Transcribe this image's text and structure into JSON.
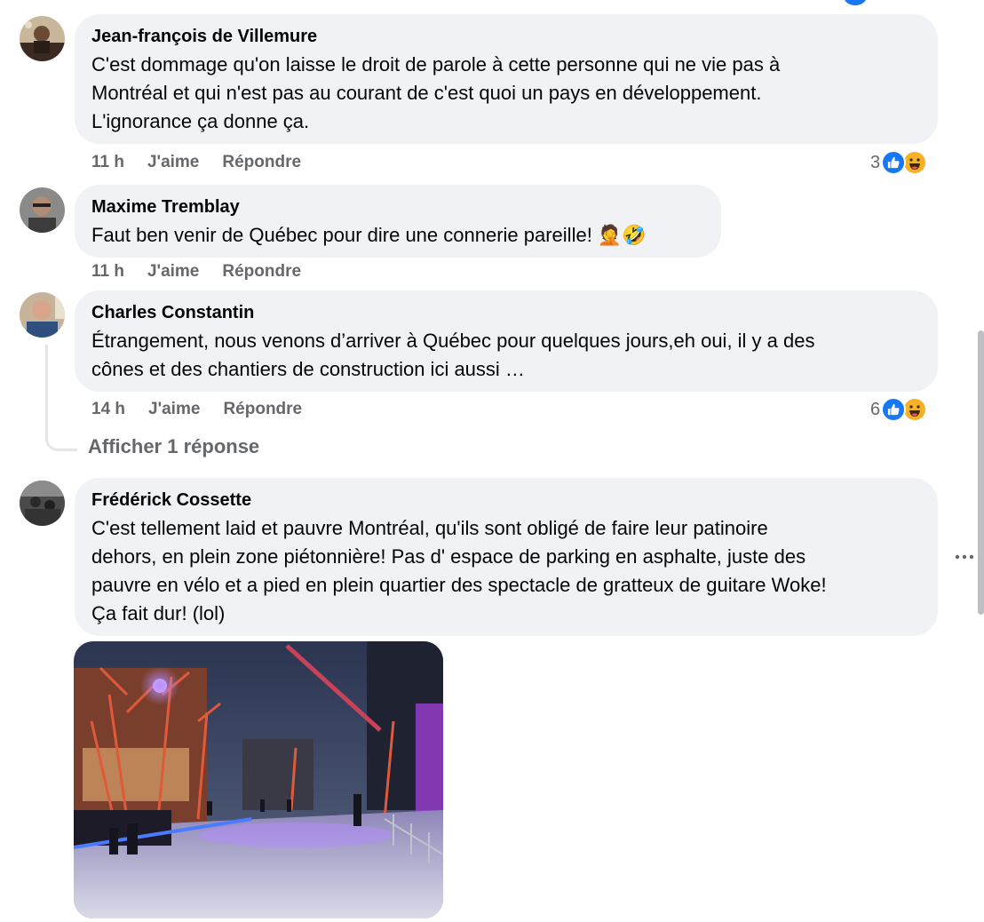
{
  "comments": [
    {
      "author": "Jean-françois de Villemure",
      "text": [
        "C'est dommage qu'on laisse le droit de parole à cette personne qui ne vie pas à",
        "Montréal et qui n'est pas au courant de c'est quoi un pays en développement.",
        "L'ignorance ça donne ça."
      ],
      "time": "11 h",
      "like_label": "J'aime",
      "reply_label": "Répondre",
      "reaction_count": "3"
    },
    {
      "author": "Maxime Tremblay",
      "text": [
        "Faut ben venir de Québec pour dire une connerie pareille! 🤦🤣"
      ],
      "time": "11 h",
      "like_label": "J'aime",
      "reply_label": "Répondre"
    },
    {
      "author": "Charles Constantin",
      "text": [
        "Étrangement, nous venons d’arriver à Québec pour quelques jours,eh oui, il y a des",
        "cônes et des chantiers de construction ici aussi …"
      ],
      "time": "14 h",
      "like_label": "J'aime",
      "reply_label": "Répondre",
      "reaction_count": "6",
      "show_replies": "Afficher 1 réponse"
    },
    {
      "author": "Frédérick Cossette",
      "text": [
        "C'est tellement laid et pauvre Montréal, qu'ils sont obligé de faire leur patinoire",
        "dehors, en plein zone piétonnière! Pas d' espace de parking en asphalte, juste des",
        "pauvre en vélo et a pied en plein quartier des spectacle de gratteux de guitare Woke!",
        "Ça fait dur! (lol)"
      ]
    }
  ],
  "icons": {
    "like": "like-icon",
    "haha": "haha-icon",
    "more": "more-options-icon"
  },
  "colors": {
    "bubble": "#f0f2f5",
    "meta": "#65676b",
    "like": "#1877f2",
    "haha": "#f7b125"
  }
}
